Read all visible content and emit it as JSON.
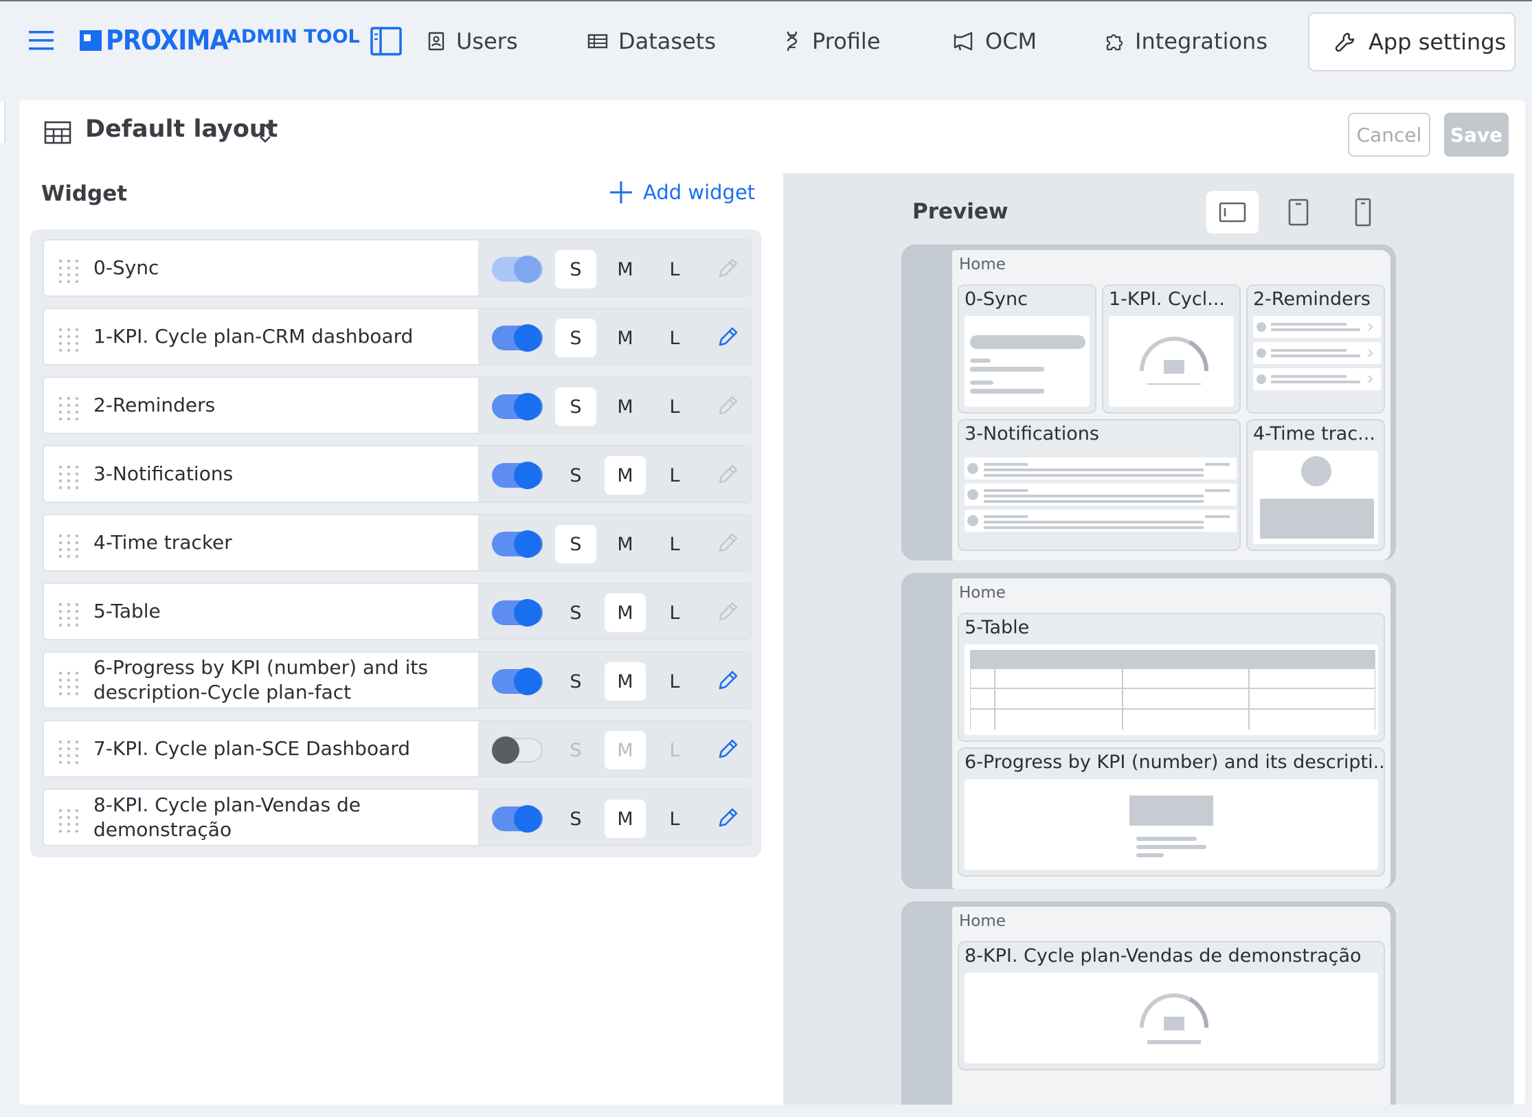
{
  "nav": {
    "logo_word": "PROXIMA",
    "logo_sub": "ADMIN TOOL",
    "items": [
      {
        "label": "Users",
        "icon": "user-badge-icon"
      },
      {
        "label": "Datasets",
        "icon": "table-icon"
      },
      {
        "label": "Profile",
        "icon": "dna-icon"
      },
      {
        "label": "OCM",
        "icon": "megaphone-icon"
      },
      {
        "label": "Integrations",
        "icon": "puzzle-icon"
      }
    ],
    "active": {
      "label": "App settings",
      "icon": "wrench-icon"
    }
  },
  "header": {
    "title": "Default layout",
    "cancel": "Cancel",
    "save": "Save"
  },
  "widgets": {
    "title": "Widget",
    "add_label": "Add widget",
    "size_labels": [
      "S",
      "M",
      "L"
    ],
    "rows": [
      {
        "name": "0-Sync",
        "enabled": true,
        "size": "S",
        "editable": false
      },
      {
        "name": "1-KPI. Cycle plan-CRM dashboard",
        "enabled": true,
        "size": "S",
        "editable": true
      },
      {
        "name": "2-Reminders",
        "enabled": true,
        "size": "S",
        "editable": false
      },
      {
        "name": "3-Notifications",
        "enabled": true,
        "size": "M",
        "editable": false
      },
      {
        "name": "4-Time tracker",
        "enabled": true,
        "size": "S",
        "editable": false
      },
      {
        "name": "5-Table",
        "enabled": true,
        "size": "M",
        "editable": false
      },
      {
        "name": "6-Progress by KPI (number) and its description-Cycle plan-fact",
        "line1": "6-Progress by KPI (number) and its",
        "line2": "description-Cycle plan-fact",
        "enabled": true,
        "size": "M",
        "editable": true
      },
      {
        "name": "7-KPI. Cycle plan-SCE Dashboard",
        "enabled": false,
        "size": "M",
        "editable": true
      },
      {
        "name": "8-KPI. Cycle plan-Vendas de demonstração",
        "line1": "8-KPI. Cycle plan-Vendas de",
        "line2": "demonstração",
        "enabled": true,
        "size": "M",
        "editable": true
      }
    ]
  },
  "preview": {
    "title": "Preview",
    "devices": [
      "desktop-icon",
      "tablet-icon",
      "phone-icon"
    ],
    "screens": [
      {
        "home": "Home",
        "tiles": [
          "0-Sync",
          "1-KPI. Cycl...",
          "2-Reminders",
          "3-Notifications",
          "4-Time trac..."
        ]
      },
      {
        "home": "Home",
        "tiles": [
          "5-Table",
          "6-Progress by KPI (number) and its descripti..."
        ]
      },
      {
        "home": "Home",
        "tiles": [
          "8-KPI. Cycle plan-Vendas de demonstração"
        ]
      }
    ]
  },
  "colors": {
    "accent": "#1a6ef0",
    "toggle_on": "#5b8ef0",
    "toggle_off_knob": "#5a5d62"
  }
}
